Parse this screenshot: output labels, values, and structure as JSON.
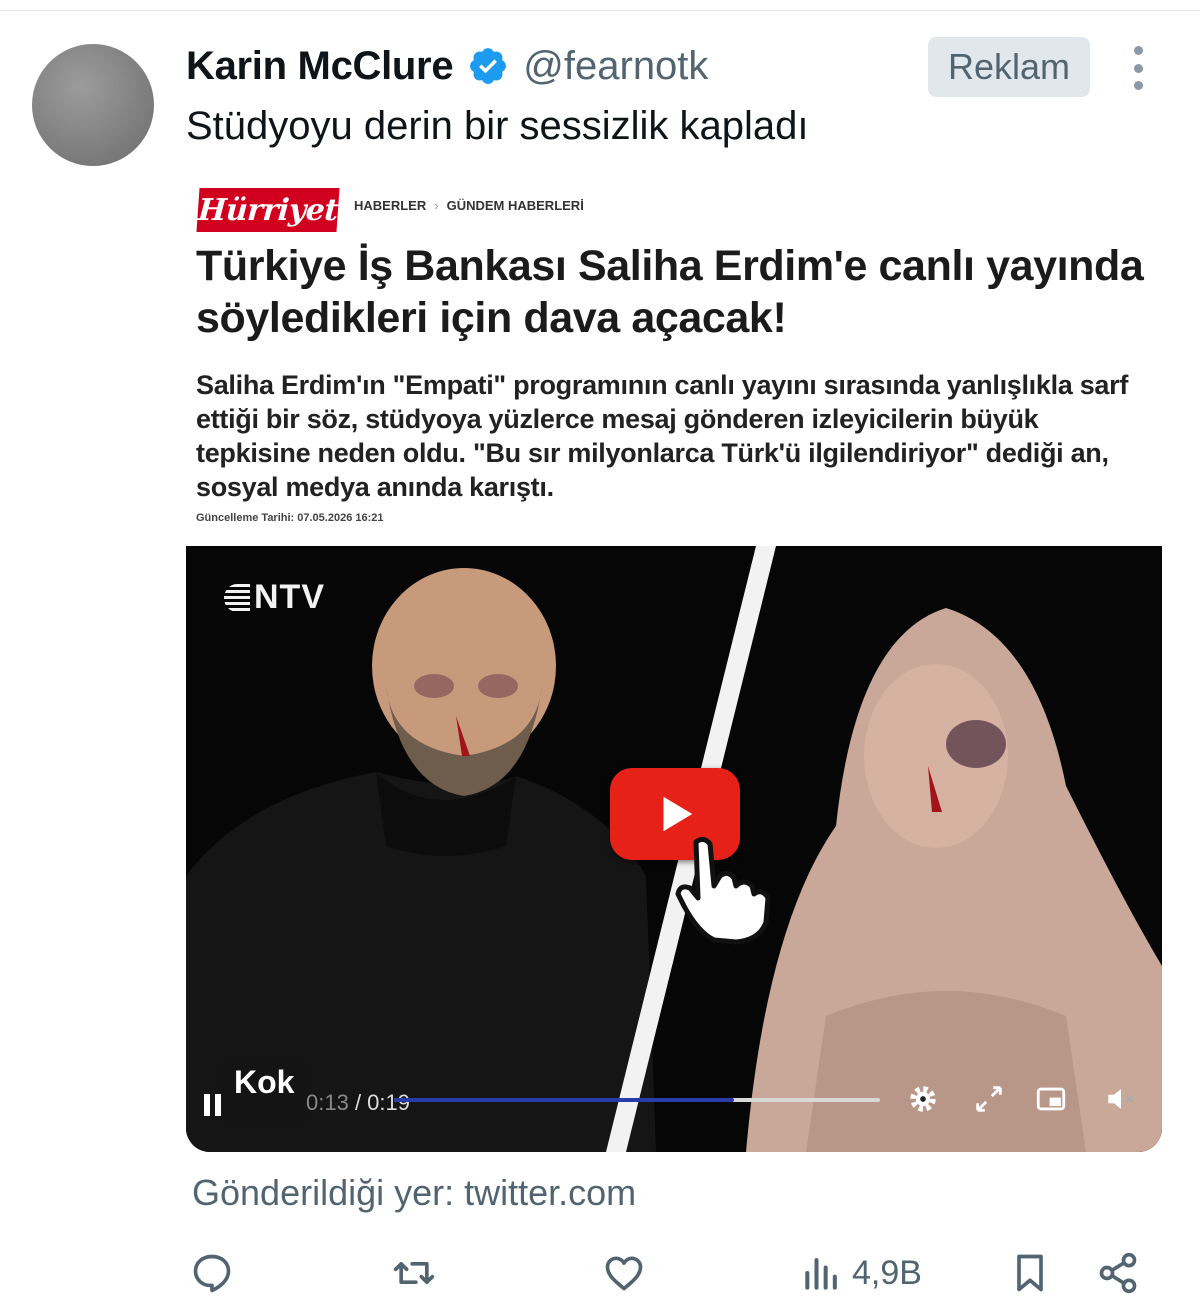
{
  "tweet": {
    "display_name": "Karin McClure",
    "handle": "@fearnotk",
    "ad_label": "Reklam",
    "text": "Stüdyoyu derin bir sessizlik kapladı",
    "source_label": "Gönderildiği yer: twitter.com"
  },
  "card": {
    "brand": "Hürriyet",
    "breadcrumb": [
      "HABERLER",
      "GÜNDEM HABERLERİ"
    ],
    "headline": "Türkiye İş Bankası Saliha Erdim'e canlı yayında söyledikleri için dava açacak!",
    "summary": "Saliha Erdim'ın \"Empati\" programının canlı yayını sırasında yanlışlıkla sarf ettiği bir söz, stüdyoya yüzlerce mesaj gönderen izleyicilerin büyük tepkisine neden oldu. \"Bu sır milyonlarca Türk'ü ilgilendiriyor\" dediği an, sosyal medya anında karıştı.",
    "updated": "Güncelleme Tarihi: 07.05.2026 16:21"
  },
  "video": {
    "channel_logo": "NTV",
    "label": "Kok",
    "current_time": "0:13",
    "duration": "/ 0:19",
    "progress": 0.7
  },
  "actions": {
    "views": "4,9B"
  },
  "icons": {
    "verified": "verified-badge-icon",
    "more": "more-vertical-icon",
    "reply": "reply-icon",
    "retweet": "retweet-icon",
    "like": "heart-icon",
    "views": "views-chart-icon",
    "bookmark": "bookmark-icon",
    "share": "share-icon"
  },
  "colors": {
    "brand_red": "#d2001f",
    "youtube_red": "#e62117",
    "verified_blue": "#1d9bf0",
    "secondary_text": "#536471"
  }
}
